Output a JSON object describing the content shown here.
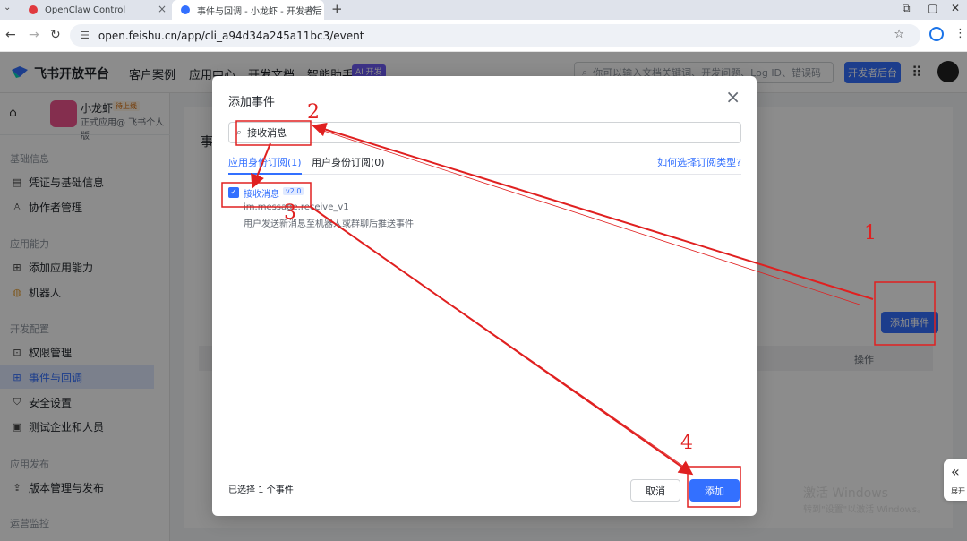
{
  "browser": {
    "tabs": [
      {
        "title": "OpenClaw Control",
        "favicon_color": "#e0393e"
      },
      {
        "title": "事件与回调 - 小龙虾 - 开发者后",
        "favicon_color": "#3370ff"
      }
    ],
    "url": "open.feishu.cn/app/cli_a94d34a245a11bc3/event"
  },
  "header": {
    "logo": "飞书开放平台",
    "nav": [
      "客户案例",
      "应用中心",
      "开发文档",
      "智能助手"
    ],
    "ai_badge": "AI 开发",
    "search_placeholder": "你可以输入文档关键词、开发问题、Log ID、错误码",
    "dev_console": "开发者后台"
  },
  "sidebar": {
    "app_name": "小龙虾",
    "app_tag": "待上线",
    "app_sub": "正式应用@ 飞书个人版",
    "groups": [
      {
        "label": "基础信息",
        "items": [
          "凭证与基础信息",
          "协作者管理"
        ]
      },
      {
        "label": "应用能力",
        "items": [
          "添加应用能力",
          "机器人"
        ]
      },
      {
        "label": "开发配置",
        "items": [
          "权限管理",
          "事件与回调",
          "安全设置",
          "测试企业和人员"
        ]
      },
      {
        "label": "应用发布",
        "items": [
          "版本管理与发布"
        ]
      },
      {
        "label": "运营监控",
        "items": []
      }
    ],
    "active_item": "事件与回调"
  },
  "background_page": {
    "title": "事",
    "add_event_button": "添加事件",
    "table_col_op": "操作"
  },
  "modal": {
    "title": "添加事件",
    "search_value": "接收消息",
    "tabs": [
      "应用身份订阅(1)",
      "用户身份订阅(0)"
    ],
    "help_link": "如何选择订阅类型?",
    "event": {
      "name": "接收消息",
      "version": "v2.0",
      "key": "im.message.receive_v1",
      "description": "用户发送新消息至机器人或群聊后推送事件",
      "checked": true
    },
    "selected_count": "已选择 1 个事件",
    "cancel": "取消",
    "add": "添加"
  },
  "annotations": {
    "color": "#e02020",
    "steps": [
      "1",
      "2",
      "3",
      "4"
    ]
  },
  "watermark": {
    "line1": "激活 Windows",
    "line2": "转到\"设置\"以激活 Windows。"
  },
  "expand_label": "展开"
}
